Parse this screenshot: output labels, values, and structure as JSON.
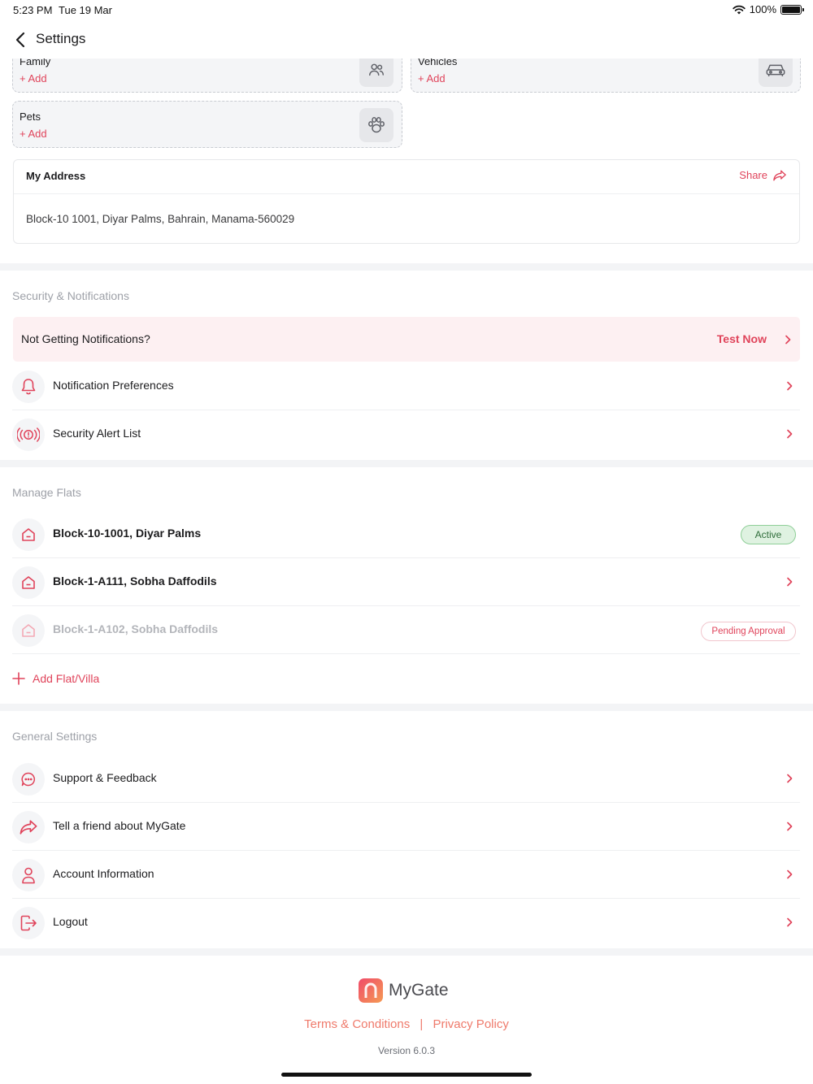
{
  "status_bar": {
    "time": "5:23 PM",
    "date": "Tue 19 Mar",
    "battery": "100%"
  },
  "nav": {
    "title": "Settings",
    "back_icon": "chevron-left-icon"
  },
  "tiles": {
    "family": {
      "label": "Family",
      "add": "+ Add",
      "icon": "users-icon"
    },
    "vehicles": {
      "label": "Vehicles",
      "add": "+ Add",
      "icon": "car-icon"
    },
    "pets": {
      "label": "Pets",
      "add": "+ Add",
      "icon": "paw-icon"
    }
  },
  "address": {
    "title": "My Address",
    "share": "Share",
    "text": "Block-10 1001, Diyar Palms, Bahrain, Manama-560029"
  },
  "security": {
    "title": "Security & Notifications",
    "test_label": "Not Getting Notifications?",
    "test_action": "Test Now",
    "items": [
      {
        "label": "Notification Preferences",
        "icon": "bell-icon"
      },
      {
        "label": "Security Alert List",
        "icon": "alarm-icon"
      }
    ]
  },
  "flats": {
    "title": "Manage Flats",
    "items": [
      {
        "label": "Block-10-1001, Diyar Palms",
        "badge": "Active"
      },
      {
        "label": "Block-1-A111, Sobha Daffodils"
      },
      {
        "label": "Block-1-A102, Sobha Daffodils",
        "badge": "Pending Approval"
      }
    ],
    "add_label": "Add Flat/Villa"
  },
  "general": {
    "title": "General Settings",
    "items": [
      {
        "label": "Support & Feedback",
        "icon": "chat-icon"
      },
      {
        "label": "Tell a friend about MyGate",
        "icon": "share-icon"
      },
      {
        "label": "Account Information",
        "icon": "user-icon"
      },
      {
        "label": "Logout",
        "icon": "logout-icon"
      }
    ]
  },
  "footer": {
    "brand": "MyGate",
    "terms": "Terms & Conditions",
    "separator": "|",
    "privacy": "Privacy Policy",
    "version": "Version 6.0.3"
  },
  "colors": {
    "accent": "#e0445b",
    "active_green": "#2f6d3a",
    "section_gray": "#9ea1a8"
  }
}
